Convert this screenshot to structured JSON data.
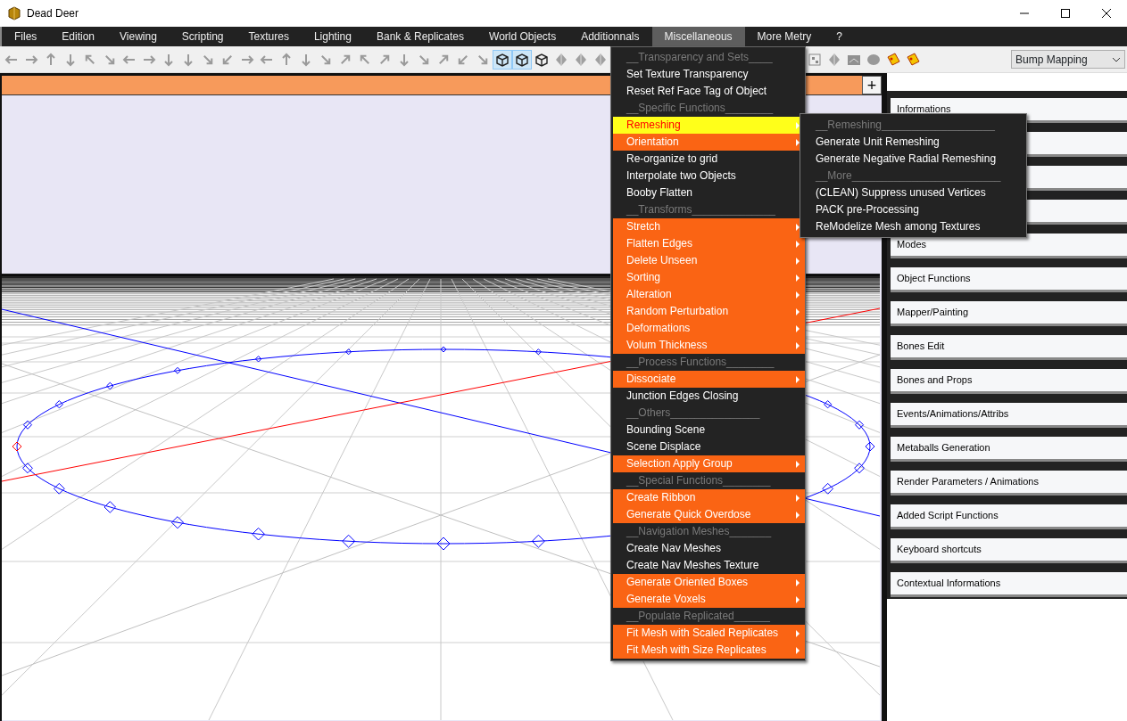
{
  "window": {
    "title": "Dead Deer"
  },
  "menubar": [
    {
      "label": "Files",
      "selected": false
    },
    {
      "label": "Edition",
      "selected": false
    },
    {
      "label": "Viewing",
      "selected": false
    },
    {
      "label": "Scripting",
      "selected": false
    },
    {
      "label": "Textures",
      "selected": false
    },
    {
      "label": "Lighting",
      "selected": false
    },
    {
      "label": "Bank & Replicates",
      "selected": false
    },
    {
      "label": "World Objects",
      "selected": false
    },
    {
      "label": "Additionnals",
      "selected": false
    },
    {
      "label": "Miscellaneous",
      "selected": true
    },
    {
      "label": "More Metry",
      "selected": false
    },
    {
      "label": "?",
      "selected": false
    }
  ],
  "toolbar": {
    "left": [
      {
        "kind": "arrow",
        "selected": false
      },
      {
        "kind": "arrow",
        "selected": false
      },
      {
        "kind": "arrow",
        "selected": false
      },
      {
        "kind": "arrow",
        "selected": false
      },
      {
        "kind": "arrow",
        "selected": false
      },
      {
        "kind": "arrow",
        "selected": false
      },
      {
        "kind": "arrow",
        "selected": false
      },
      {
        "kind": "arrow",
        "selected": false
      },
      {
        "kind": "arrow",
        "selected": false
      },
      {
        "kind": "arrow",
        "selected": false
      },
      {
        "kind": "arrow",
        "selected": false
      },
      {
        "kind": "arrow",
        "selected": false
      },
      {
        "kind": "arrow",
        "selected": false
      },
      {
        "kind": "arrow",
        "selected": false
      },
      {
        "kind": "arrow",
        "selected": false
      },
      {
        "kind": "arrow",
        "selected": false
      },
      {
        "kind": "arrow",
        "selected": false
      },
      {
        "kind": "arrow",
        "selected": false
      },
      {
        "kind": "arrow",
        "selected": false
      },
      {
        "kind": "arrow",
        "selected": false
      },
      {
        "kind": "arrow",
        "selected": false
      },
      {
        "kind": "arrow",
        "selected": false
      },
      {
        "kind": "arrow",
        "selected": false
      },
      {
        "kind": "arrow",
        "selected": false
      },
      {
        "kind": "arrow",
        "selected": false
      },
      {
        "kind": "cube",
        "selected": true
      },
      {
        "kind": "cube",
        "selected": true
      },
      {
        "kind": "cube",
        "selected": false
      },
      {
        "kind": "shape",
        "selected": false
      },
      {
        "kind": "shape",
        "selected": false
      },
      {
        "kind": "shape",
        "selected": false
      }
    ],
    "right": [
      {
        "kind": "grid",
        "selected": false
      },
      {
        "kind": "shape",
        "selected": false
      },
      {
        "kind": "box",
        "selected": false
      },
      {
        "kind": "circle",
        "selected": false
      },
      {
        "kind": "tag",
        "selected": false
      },
      {
        "kind": "tag",
        "selected": false
      }
    ],
    "render_mode": "Bump Mapping"
  },
  "viewport": {
    "add_button": "+"
  },
  "side_panels": [
    {
      "label": "Informations"
    },
    {
      "covered": true
    },
    {
      "covered": true
    },
    {
      "covered": true
    },
    {
      "label": "Modes"
    },
    {
      "label": "Object Functions"
    },
    {
      "label": "Mapper/Painting"
    },
    {
      "label": "Bones Edit"
    },
    {
      "label": "Bones and Props"
    },
    {
      "label": "Events/Animations/Attribs"
    },
    {
      "label": "Metaballs Generation"
    },
    {
      "label": "Render Parameters / Animations"
    },
    {
      "label": "Added Script Functions"
    },
    {
      "label": "Keyboard shortcuts"
    },
    {
      "label": "Contextual Informations"
    }
  ],
  "menu": [
    {
      "kind": "header",
      "label": "__Transparency and Sets____"
    },
    {
      "kind": "command",
      "label": "Set Texture Transparency",
      "selected": false
    },
    {
      "kind": "command",
      "label": "Reset Ref Face Tag of Object",
      "selected": false
    },
    {
      "kind": "header",
      "label": "__Specific Functions________"
    },
    {
      "kind": "submenu",
      "label": "Remeshing",
      "selected": true
    },
    {
      "kind": "submenu",
      "label": "Orientation",
      "selected": false
    },
    {
      "kind": "command",
      "label": "Re-organize to grid",
      "selected": false
    },
    {
      "kind": "command",
      "label": "Interpolate two Objects",
      "selected": false
    },
    {
      "kind": "command",
      "label": "Booby Flatten",
      "selected": false
    },
    {
      "kind": "header",
      "label": "__Transforms______________"
    },
    {
      "kind": "submenu",
      "label": "Stretch",
      "selected": false
    },
    {
      "kind": "submenu",
      "label": "Flatten Edges",
      "selected": false
    },
    {
      "kind": "submenu",
      "label": "Delete Unseen",
      "selected": false
    },
    {
      "kind": "submenu",
      "label": "Sorting",
      "selected": false
    },
    {
      "kind": "submenu",
      "label": "Alteration",
      "selected": false
    },
    {
      "kind": "submenu",
      "label": "Random Perturbation",
      "selected": false
    },
    {
      "kind": "submenu",
      "label": "Deformations",
      "selected": false
    },
    {
      "kind": "submenu",
      "label": "Volum Thickness",
      "selected": false
    },
    {
      "kind": "header",
      "label": "__Process Functions________"
    },
    {
      "kind": "submenu",
      "label": "Dissociate",
      "selected": false
    },
    {
      "kind": "command",
      "label": "Junction Edges Closing",
      "selected": false
    },
    {
      "kind": "header",
      "label": "__Others_______________"
    },
    {
      "kind": "command",
      "label": "Bounding Scene",
      "selected": false
    },
    {
      "kind": "command",
      "label": "Scene Displace",
      "selected": false
    },
    {
      "kind": "submenu",
      "label": "Selection Apply Group",
      "selected": false
    },
    {
      "kind": "header",
      "label": "__Special Functions________"
    },
    {
      "kind": "submenu",
      "label": "Create Ribbon",
      "selected": false
    },
    {
      "kind": "submenu",
      "label": "Generate Quick Overdose",
      "selected": false
    },
    {
      "kind": "header",
      "label": "__Navigation Meshes_______"
    },
    {
      "kind": "command",
      "label": "Create Nav Meshes",
      "selected": false
    },
    {
      "kind": "command",
      "label": "Create Nav Meshes Texture",
      "selected": false
    },
    {
      "kind": "submenu",
      "label": "Generate Oriented Boxes",
      "selected": false
    },
    {
      "kind": "submenu",
      "label": "Generate Voxels",
      "selected": false
    },
    {
      "kind": "header",
      "label": "__Populate Replicated______"
    },
    {
      "kind": "submenu",
      "label": "Fit Mesh with Scaled Replicates",
      "selected": false
    },
    {
      "kind": "submenu",
      "label": "Fit Mesh with Size Replicates",
      "selected": false
    }
  ],
  "submenu": [
    {
      "kind": "header",
      "label": "__Remeshing___________________"
    },
    {
      "kind": "command",
      "label": "Generate Unit Remeshing",
      "selected": false
    },
    {
      "kind": "command",
      "label": "Generate Negative Radial Remeshing",
      "selected": false
    },
    {
      "kind": "header",
      "label": "__More_________________________"
    },
    {
      "kind": "command",
      "label": "(CLEAN) Suppress unused Vertices",
      "selected": false
    },
    {
      "kind": "command",
      "label": "PACK pre-Processing",
      "selected": false
    },
    {
      "kind": "command",
      "label": "ReModelize Mesh among Textures",
      "selected": false
    }
  ]
}
